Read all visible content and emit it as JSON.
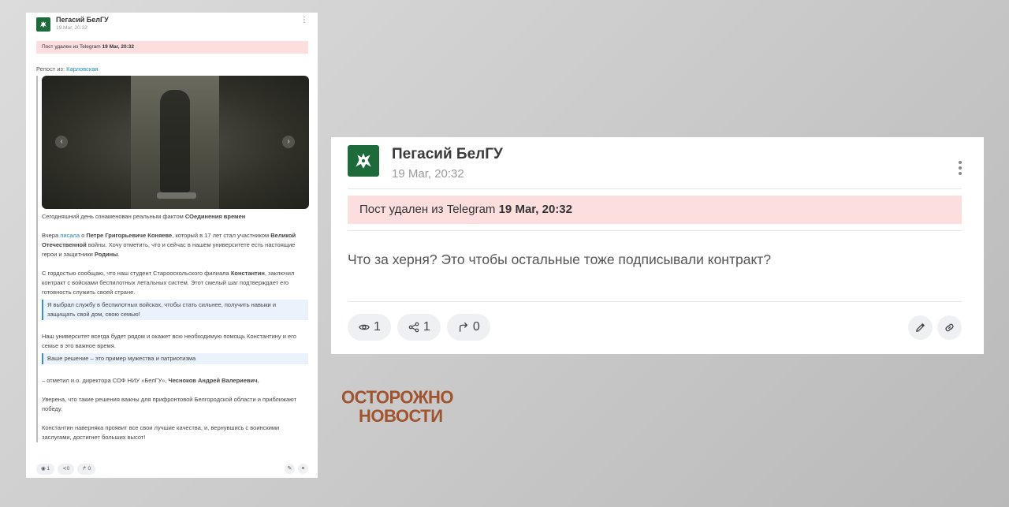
{
  "small_post": {
    "author": "Пегасий БелГУ",
    "date": "19 Мar, 20:32",
    "banner_prefix": "Пост удален из Telegram",
    "banner_date": "19 Мar, 20:32",
    "repost_label": "Репост из:",
    "repost_source": "Карловская",
    "paragraphs": [
      {
        "pre": "Сегодняшний день ознаменован реальным фактом ",
        "bold": "СОединения времен",
        "post": ""
      },
      {
        "pre": "Вчера ",
        "link": "писала",
        "mid": " о ",
        "bold": "Петре Григорьевиче Коняеве",
        "post": ", который в 17 лет стал участником ",
        "bold2": "Великой Отечественной",
        "post2": " войны. Хочу отметить, что и сейчас в нашем университете есть настоящие герои и защитники ",
        "bold3": "Родины",
        "post3": "."
      },
      {
        "pre": "С гордостью сообщаю, что наш студент Старооскольского филиала ",
        "bold": "Константин",
        "post": ", заключил контракт с войсками беспилотных летальных систем. Этот смелый шаг подтверждает его готовность служить своей стране."
      }
    ],
    "quote1": "Я выбрал службу в беспилотных войсках, чтобы стать сильнее, получить навыки и защищать свой дом, свою семью!",
    "paragraph4": "Наш университет всегда будет рядом и окажет всю необходимую помощь Константину и его семье в это важное время.",
    "quote2": "Ваше решение – это пример мужества и патриотизма",
    "paragraph5_pre": "– отметил и.о. директора СОФ НИУ «БелГУ», ",
    "paragraph5_bold": "Чесноков Андрей Валериевич.",
    "paragraph6": "Уверена, что такие решения важны для прифронтовой Белгородской области и приближают победу.",
    "paragraph7": "Константин наверняка проявит все свои лучшие качества, и, вернувшись с воинскими заслугами, достигнет больших высот!",
    "views": "1",
    "shares": "0",
    "reposts": "0"
  },
  "big_post": {
    "author": "Пегасий БелГУ",
    "date": "19 Мar, 20:32",
    "banner_prefix": "Пост удален из Telegram",
    "banner_date": "19 Мar, 20:32",
    "text": "Что за херня? Это чтобы остальные тоже подписывали контракт?",
    "views": "1",
    "shares": "1",
    "reposts": "0"
  },
  "watermark": {
    "line1": "ОСТОРОЖНО",
    "line2": "НОВОСТИ"
  },
  "colors": {
    "brand_green": "#1d6b3a",
    "banner_pink": "#fcdede",
    "link_blue": "#1e88b5",
    "watermark": "#a0532f"
  }
}
